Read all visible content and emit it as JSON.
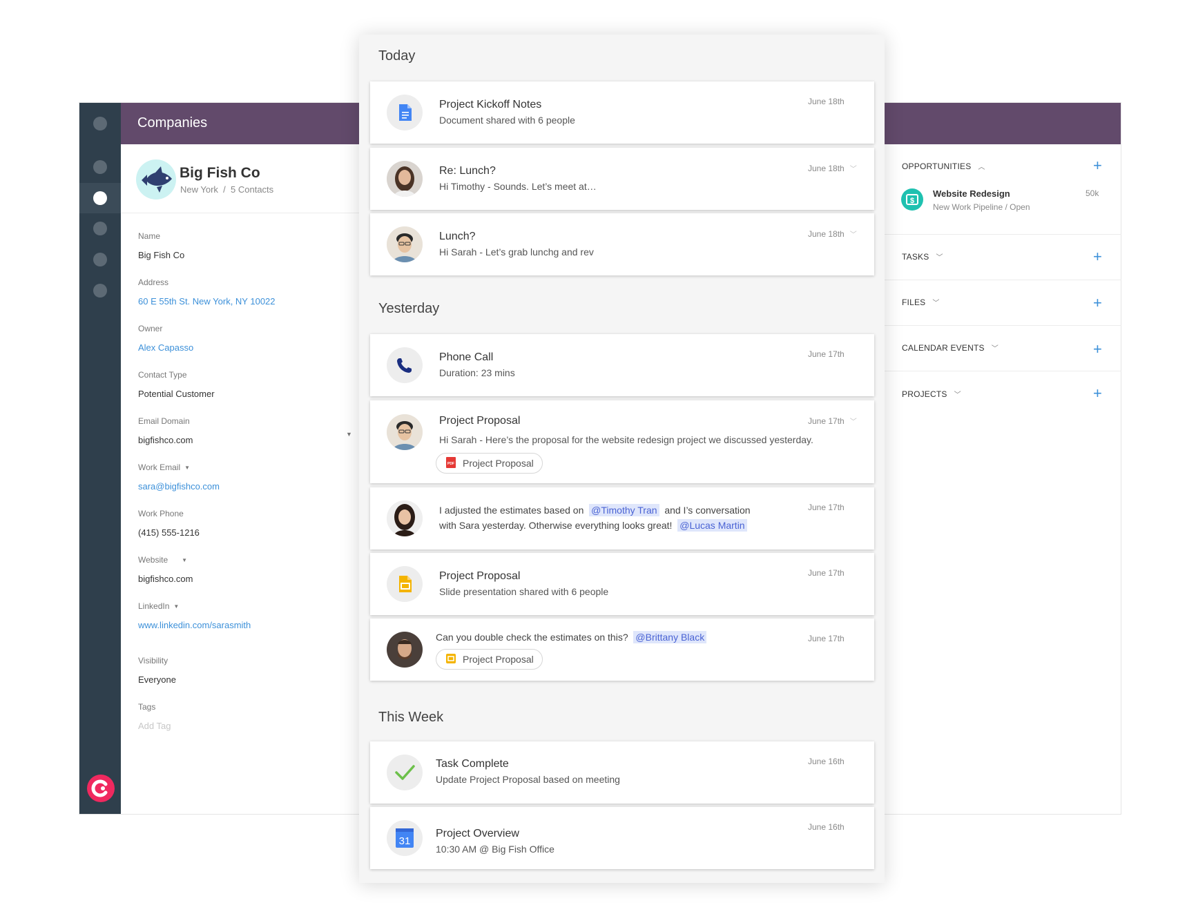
{
  "sidebar": {
    "dots": 5
  },
  "header": {
    "title": "Companies"
  },
  "company": {
    "name": "Big Fish Co",
    "location": "New York",
    "separator": "/",
    "contacts": "5 Contacts"
  },
  "fields": [
    {
      "label": "Name",
      "value": "Big Fish Co"
    },
    {
      "label": "Address",
      "value": "60 E 55th St. New York, NY 10022"
    },
    {
      "label": "Owner",
      "value": "Alex Capasso"
    },
    {
      "label": "Contact Type",
      "value": "Potential Customer"
    },
    {
      "label": "Email Domain",
      "value": "bigfishco.com"
    },
    {
      "label": "Work Email",
      "value": "sara@bigfishco.com"
    },
    {
      "label": "Work Phone",
      "value": "(415) 555-1216"
    },
    {
      "label": "Website",
      "value": "bigfishco.com"
    },
    {
      "label": "LinkedIn",
      "value": "www.linkedin.com/sarasmith"
    },
    {
      "label": "Visibility",
      "value": "Everyone"
    },
    {
      "label": "Tags",
      "value": "Add Tag"
    }
  ],
  "right": {
    "opportunities": "OPPORTUNITIES",
    "opportunity": {
      "title": "Website Redesign",
      "sub": "New Work Pipeline / Open",
      "value": "50k"
    },
    "tasks": "TASKS",
    "files": "FILES",
    "calendar": "CALENDAR EVENTS",
    "projects": "PROJECTS"
  },
  "feed": {
    "today": "Today",
    "yesterday": "Yesterday",
    "this_week": "This Week",
    "cards": [
      {
        "title": "Project Kickoff Notes",
        "sub": "Document shared with 6 people",
        "date": "June 18th"
      },
      {
        "title": "Re: Lunch?",
        "sub": "Hi Timothy -  Sounds. Let’s meet at…",
        "date": "June 18th"
      },
      {
        "title": "Lunch?",
        "sub": "Hi Sarah - Let’s grab lunchg and rev",
        "date": "June 18th"
      },
      {
        "title": "Phone Call",
        "sub": "Duration: 23 mins",
        "date": "June 17th"
      },
      {
        "title": "Project Proposal",
        "sub": "Hi Sarah - Here’s the proposal for the website redesign project we discussed yesterday.",
        "date": "June 17th",
        "chip": "Project Proposal"
      },
      {
        "msg1": "I adjusted the estimates based on",
        "mention1": "@Timothy Tran",
        "msg2": "and I’s conversation",
        "msg3": "with Sara yesterday. Otherwise everything looks great!",
        "mention2": "@Lucas Martin",
        "date": "June 17th"
      },
      {
        "title": "Project Proposal",
        "sub": "Slide presentation shared with 6 people",
        "date": "June 17th"
      },
      {
        "msg1": "Can you double check the estimates on this?",
        "mention1": "@Brittany Black",
        "date": "June 17th",
        "chip": "Project Proposal"
      },
      {
        "title": "Task Complete",
        "sub": "Update Project Proposal based on meeting",
        "date": "June 16th"
      },
      {
        "title": "Project Overview",
        "sub": "10:30 AM @ Big Fish Office",
        "date": "June 16th",
        "cal_day": "31"
      }
    ]
  },
  "colors": {
    "header": "#624a6b",
    "rail": "#2f3f4c",
    "accent": "#3c90d9",
    "brand": "#f0295f"
  }
}
